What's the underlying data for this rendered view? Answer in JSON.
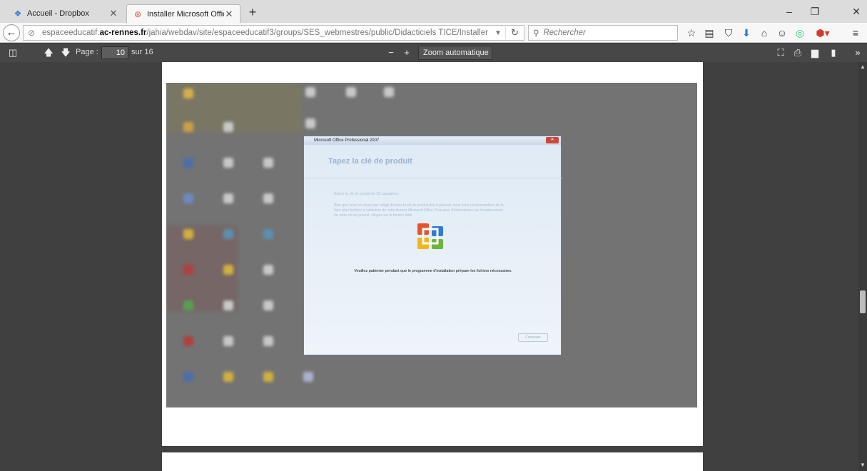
{
  "tabs": [
    {
      "label": "Accueil - Dropbox",
      "icon": "dropbox-icon"
    },
    {
      "label": "Installer Microsoft Office....",
      "icon": "pdf-icon"
    }
  ],
  "window_controls": {
    "minimize": "–",
    "restore": "❐",
    "close": "✕"
  },
  "nav": {
    "back": "←",
    "url_prefix": "espaceeducatif.",
    "url_domain": "ac-rennes.fr",
    "url_suffix": "/jahia/webdav/site/espaceeducatif3/groups/SES_webmestres/public/Didacticiels TICE/Installer Microsoft Office.¡",
    "search_placeholder": "Rechercher"
  },
  "pdf_toolbar": {
    "page_label": "Page :",
    "page_value": "10",
    "page_total": "sur 16",
    "zoom_minus": "−",
    "zoom_plus": "+",
    "zoom_value": "Zoom automatique"
  },
  "dialog": {
    "title": "Microsoft Office Professional 2007",
    "heading": "Tapez la clé de produit",
    "faint_line_1": "Entrez la clé de produit de 25 caractères.",
    "faint_line_2": "Bien que vous ne soyez pas obligé d'entrer la clé de produit dès à présent, nous vous recommandons de la",
    "faint_line_3": "faire pour faciliter la validation de votre licence Microsoft Office. Pour plus d'informations sur l'emplacement",
    "faint_line_4": "de votre clé de produit, cliquez sur le bouton Aide.",
    "message": "Veuillez patienter pendant que le programme d'installation prépare les fichiers nécessaires.",
    "button": "Continuer"
  },
  "colors": {
    "office_red": "#e5532b",
    "office_blue": "#2f7bd6",
    "office_green": "#6cb33f",
    "office_yellow": "#f2b41c"
  }
}
